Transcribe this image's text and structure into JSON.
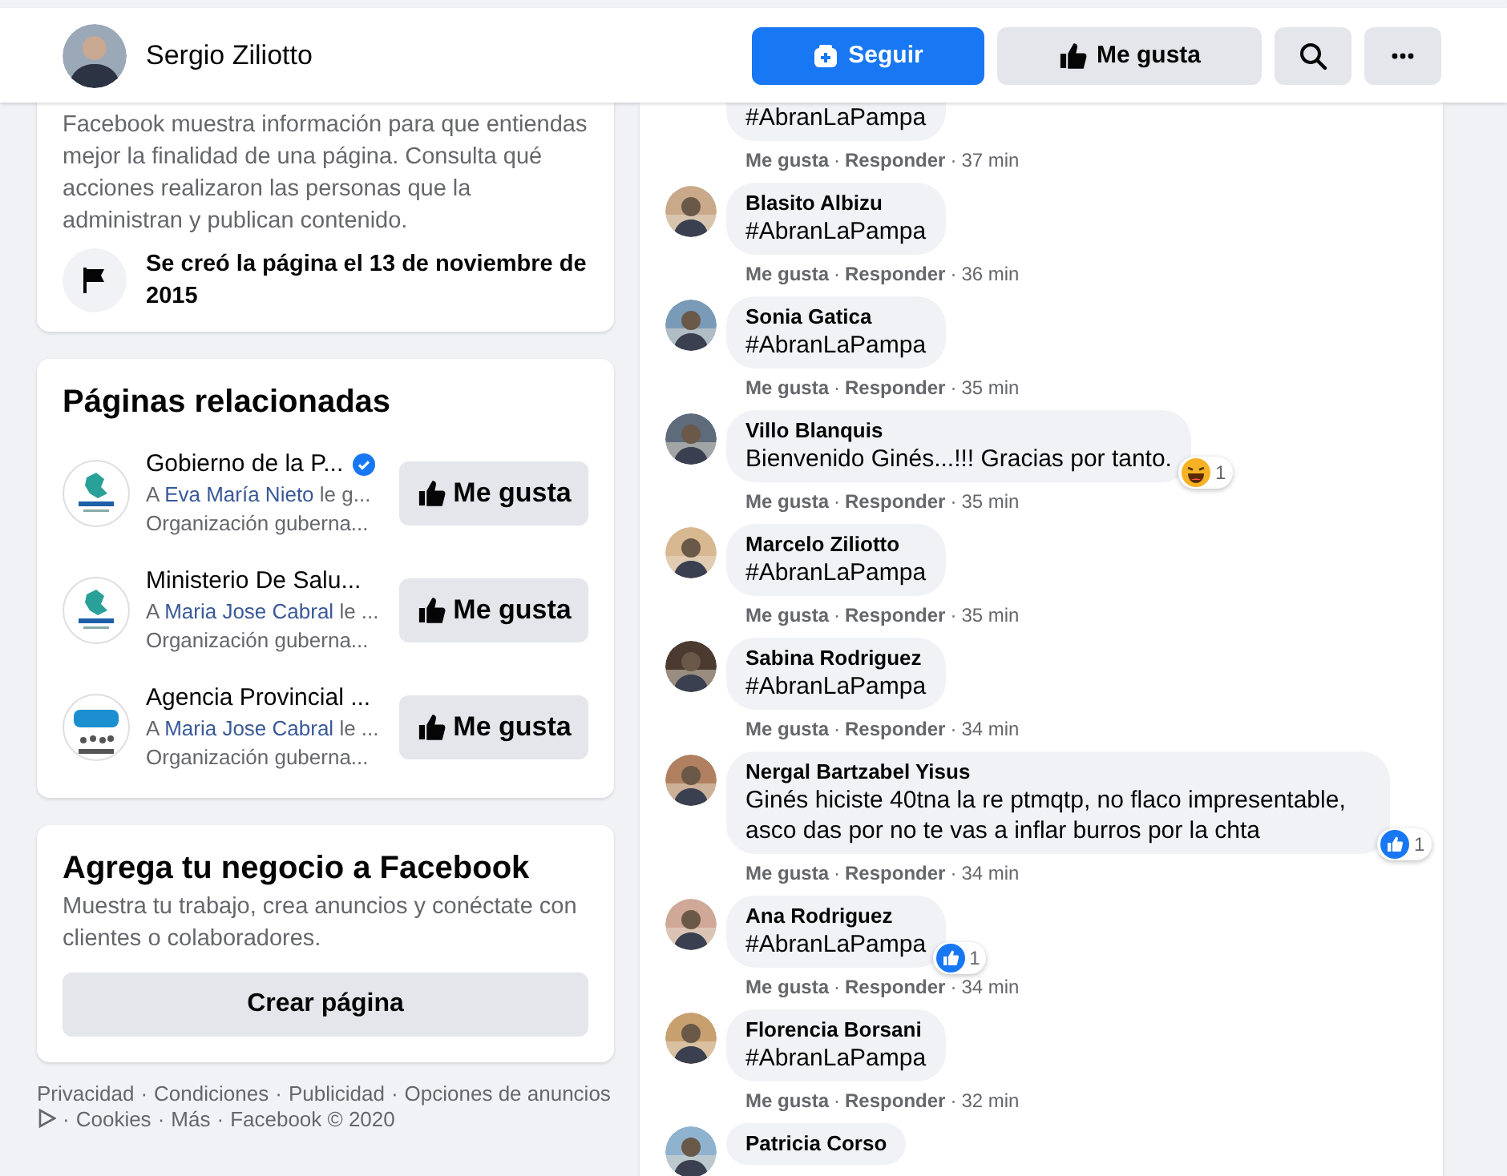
{
  "header": {
    "page_name": "Sergio Ziliotto",
    "buttons": [
      {
        "kind": "follow",
        "label": "Seguir"
      },
      {
        "kind": "like",
        "label": "Me gusta"
      },
      {
        "kind": "search"
      },
      {
        "kind": "more"
      }
    ]
  },
  "transparency": {
    "text": "Facebook muestra información para que entiendas mejor la finalidad de una página. Consulta qué acciones realizaron las personas que la administran y publican contenido.",
    "created": "Se creó la página el 13 de noviembre de 2015"
  },
  "related_pages": {
    "title": "Páginas relacionadas",
    "items": [
      {
        "name": "Gobierno de la P...",
        "verified": true,
        "kind": "emblem",
        "prefix": "A",
        "friend": "Eva María Nieto",
        "suffix": "le g...",
        "category": "Organización guberna...",
        "button": "Me gusta"
      },
      {
        "name": "Ministerio De Salu...",
        "verified": false,
        "kind": "emblem",
        "prefix": "A",
        "friend": "Maria Jose Cabral",
        "suffix": "le ...",
        "category": "Organización guberna...",
        "button": "Me gusta"
      },
      {
        "name": "Agencia Provincial ...",
        "verified": false,
        "kind": "monogram",
        "prefix": "A",
        "friend": "Maria Jose Cabral",
        "suffix": "le ...",
        "category": "Organización guberna...",
        "button": "Me gusta"
      }
    ]
  },
  "business": {
    "title": "Agrega tu negocio a Facebook",
    "text": "Muestra tu trabajo, crea anuncios y conéctate con clientes o colaboradores.",
    "button": "Crear página"
  },
  "footer": {
    "separator": "·",
    "links": [
      "Privacidad",
      "Condiciones",
      "Publicidad",
      "Opciones de anuncios",
      "Cookies",
      "Más",
      "Facebook © 2020"
    ]
  },
  "comments": {
    "separator": "·",
    "items": [
      {
        "text": "#AbranLaPampa",
        "like": "Me gusta",
        "reply": "Responder",
        "time": "37 min"
      },
      {
        "author": "Blasito Albizu",
        "text": "#AbranLaPampa",
        "like": "Me gusta",
        "reply": "Responder",
        "time": "36 min"
      },
      {
        "author": "Sonia Gatica",
        "text": "#AbranLaPampa",
        "like": "Me gusta",
        "reply": "Responder",
        "time": "35 min"
      },
      {
        "author": "Villo Blanquis",
        "text": "Bienvenido Ginés...!!! Gracias por tanto.",
        "like": "Me gusta",
        "reply": "Responder",
        "time": "35 min",
        "reaction": {
          "kind": "haha",
          "count": "1"
        }
      },
      {
        "author": "Marcelo Ziliotto",
        "text": "#AbranLaPampa",
        "like": "Me gusta",
        "reply": "Responder",
        "time": "35 min"
      },
      {
        "author": "Sabina Rodriguez",
        "text": "#AbranLaPampa",
        "like": "Me gusta",
        "reply": "Responder",
        "time": "34 min"
      },
      {
        "author": "Nergal Bartzabel Yisus",
        "text": "Ginés hiciste 40tna la re ptmqtp, no flaco impresentable, asco das por no te vas a inflar burros por la chta",
        "like": "Me gusta",
        "reply": "Responder",
        "time": "34 min",
        "reaction": {
          "kind": "like",
          "count": "1"
        }
      },
      {
        "author": "Ana Rodriguez",
        "text": "#AbranLaPampa",
        "like": "Me gusta",
        "reply": "Responder",
        "time": "34 min",
        "reaction": {
          "kind": "like",
          "count": "1"
        }
      },
      {
        "author": "Florencia Borsani",
        "text": "#AbranLaPampa",
        "like": "Me gusta",
        "reply": "Responder",
        "time": "32 min"
      },
      {
        "author": "Patricia Corso"
      }
    ]
  }
}
